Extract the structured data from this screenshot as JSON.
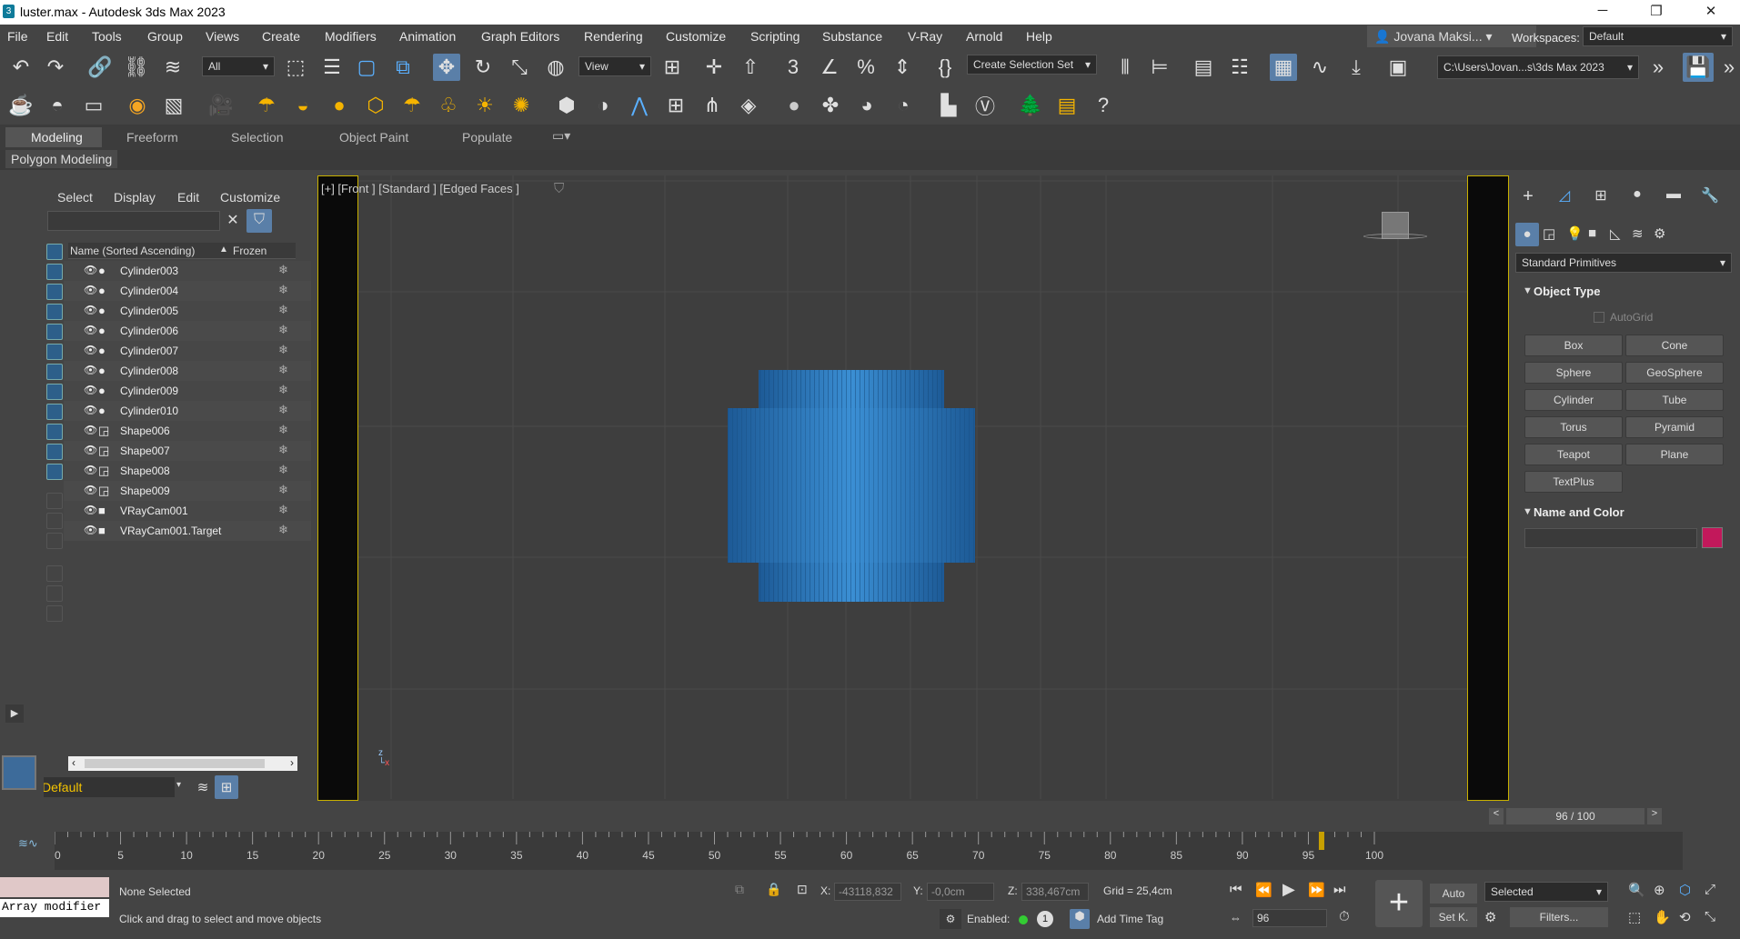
{
  "window": {
    "title": "luster.max - Autodesk 3ds Max 2023"
  },
  "menu": [
    "File",
    "Edit",
    "Tools",
    "Group",
    "Views",
    "Create",
    "Modifiers",
    "Animation",
    "Graph Editors",
    "Rendering",
    "Customize",
    "Scripting",
    "Substance",
    "V-Ray",
    "Arnold",
    "Help"
  ],
  "user": {
    "name": "Jovana Maksi...",
    "workspaces_label": "Workspaces:",
    "workspace": "Default"
  },
  "toolbar": {
    "filter": "All",
    "view": "View",
    "selection_set": "Create Selection Set",
    "project_path": "C:\\Users\\Jovan...s\\3ds Max 2023"
  },
  "ribbon": {
    "tabs": [
      "Modeling",
      "Freeform",
      "Selection",
      "Object Paint",
      "Populate"
    ],
    "panel": "Polygon Modeling"
  },
  "explorer": {
    "tabs": [
      "Select",
      "Display",
      "Edit",
      "Customize"
    ],
    "col_name": "Name (Sorted Ascending)",
    "col_frozen": "Frozen",
    "items": [
      {
        "name": "Cylinder003",
        "type": "geometry"
      },
      {
        "name": "Cylinder004",
        "type": "geometry"
      },
      {
        "name": "Cylinder005",
        "type": "geometry"
      },
      {
        "name": "Cylinder006",
        "type": "geometry"
      },
      {
        "name": "Cylinder007",
        "type": "geometry"
      },
      {
        "name": "Cylinder008",
        "type": "geometry"
      },
      {
        "name": "Cylinder009",
        "type": "geometry"
      },
      {
        "name": "Cylinder010",
        "type": "geometry"
      },
      {
        "name": "Shape006",
        "type": "shape"
      },
      {
        "name": "Shape007",
        "type": "shape"
      },
      {
        "name": "Shape008",
        "type": "shape"
      },
      {
        "name": "Shape009",
        "type": "shape"
      },
      {
        "name": "VRayCam001",
        "type": "camera"
      },
      {
        "name": "VRayCam001.Target",
        "type": "camera"
      }
    ],
    "layer": "Default"
  },
  "viewport": {
    "label": "[+] [Front ] [Standard ] [Edged Faces ]"
  },
  "command_panel": {
    "category": "Standard Primitives",
    "object_type_title": "Object Type",
    "autogrid": "AutoGrid",
    "buttons": [
      "Box",
      "Cone",
      "Sphere",
      "GeoSphere",
      "Cylinder",
      "Tube",
      "Torus",
      "Pyramid",
      "Teapot",
      "Plane",
      "TextPlus"
    ],
    "name_color_title": "Name and Color",
    "color": "#c2185b"
  },
  "timeline": {
    "frame_label": "96 / 100",
    "ticks": [
      "0",
      "5",
      "10",
      "15",
      "20",
      "25",
      "30",
      "35",
      "40",
      "45",
      "50",
      "55",
      "60",
      "65",
      "70",
      "75",
      "80",
      "85",
      "90",
      "95",
      "100"
    ],
    "current_frame": 96
  },
  "status": {
    "maxscript": "Array modifier",
    "selection": "None Selected",
    "prompt": "Click and drag to select and move objects",
    "x_label": "X:",
    "x": "-43118,832",
    "y_label": "Y:",
    "y": "-0,0cm",
    "z_label": "Z:",
    "z": "338,467cm",
    "grid": "Grid = 25,4cm",
    "enabled_label": "Enabled:",
    "add_time_tag": "Add Time Tag",
    "auto": "Auto",
    "set_key": "Set K.",
    "selected": "Selected",
    "filters": "Filters...",
    "frame": "96"
  }
}
